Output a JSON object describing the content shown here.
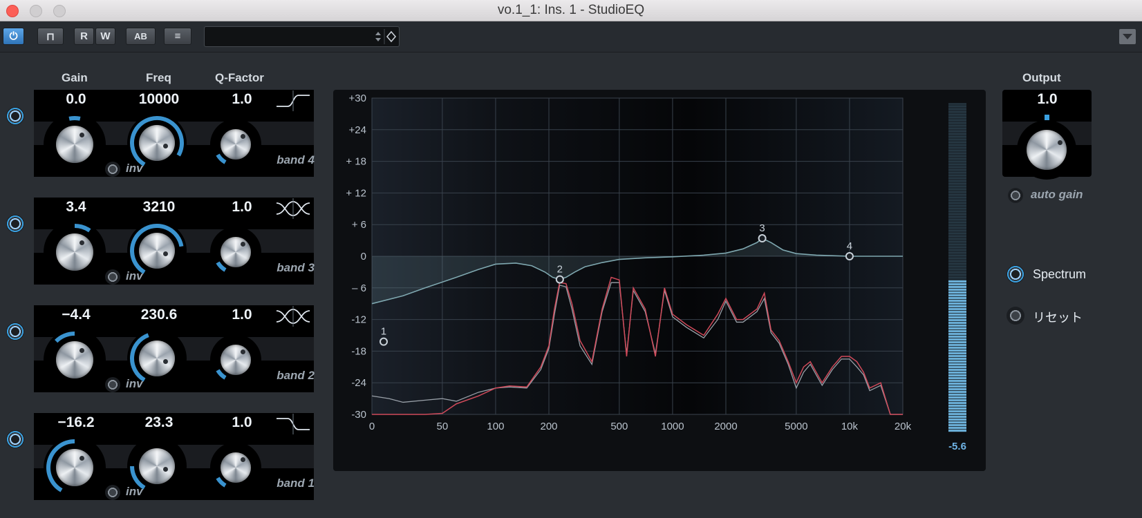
{
  "window": {
    "title": "vo.1_1: Ins. 1 - StudioEQ"
  },
  "toolbar": {
    "buttons": [
      {
        "name": "power",
        "glyph": "⏻"
      },
      {
        "name": "bypass",
        "glyph": "⊓"
      },
      {
        "name": "read",
        "glyph": "R"
      },
      {
        "name": "write",
        "glyph": "W"
      },
      {
        "name": "ab-compare",
        "glyph": "AB"
      },
      {
        "name": "settings",
        "glyph": "≡"
      }
    ],
    "preset_value": ""
  },
  "columns": {
    "gain": "Gain",
    "freq": "Freq",
    "q": "Q-Factor"
  },
  "bands": [
    {
      "id": 4,
      "label": "band 4",
      "enabled": true,
      "gain": "0.0",
      "freq": "10000",
      "q": "1.0",
      "inv": "inv",
      "shape": "high-shelf"
    },
    {
      "id": 3,
      "label": "band 3",
      "enabled": true,
      "gain": "3.4",
      "freq": "3210",
      "q": "1.0",
      "inv": "inv",
      "shape": "peak"
    },
    {
      "id": 2,
      "label": "band 2",
      "enabled": true,
      "gain": "−4.4",
      "freq": "230.6",
      "q": "1.0",
      "inv": "inv",
      "shape": "peak"
    },
    {
      "id": 1,
      "label": "band 1",
      "enabled": true,
      "gain": "−16.2",
      "freq": "23.3",
      "q": "1.0",
      "inv": "inv",
      "shape": "low-shelf"
    }
  ],
  "output": {
    "label": "Output",
    "value": "1.0",
    "auto_gain": "auto gain"
  },
  "spectrum": {
    "label": "Spectrum",
    "on": true
  },
  "reset": {
    "label": "リセット"
  },
  "meter": {
    "value": "-5.6"
  },
  "chart_data": {
    "type": "line",
    "y_tick_labels": [
      "+30",
      "+24",
      "+ 18",
      "+ 12",
      "+ 6",
      "0",
      "– 6",
      "-12",
      "-18",
      "-24",
      "-30"
    ],
    "x_tick_labels": [
      "0",
      "50",
      "100",
      "200",
      "500",
      "1000",
      "2000",
      "5000",
      "10k",
      "20k"
    ],
    "ylim": [
      -30,
      30
    ],
    "xlim": [
      20,
      20000
    ],
    "x_scale": "log",
    "nodes": [
      {
        "label": "1",
        "freq": 23.3,
        "gain": -16.2
      },
      {
        "label": "2",
        "freq": 230.6,
        "gain": -4.4
      },
      {
        "label": "3",
        "freq": 3210,
        "gain": 3.4
      },
      {
        "label": "4",
        "freq": 10000,
        "gain": 0.0
      }
    ],
    "series": [
      {
        "x": [
          20,
          30,
          40,
          60,
          80,
          100,
          130,
          160,
          190,
          210,
          230,
          250,
          280,
          320,
          400,
          500,
          700,
          1000,
          1500,
          2000,
          2500,
          3000,
          3210,
          3600,
          4200,
          5000,
          6500,
          8000,
          10000,
          15000,
          20000
        ],
        "y": [
          -9,
          -7.5,
          -6,
          -4,
          -2.5,
          -1.5,
          -1.3,
          -1.8,
          -3,
          -4,
          -4.4,
          -4,
          -3,
          -2,
          -1.2,
          -0.6,
          -0.3,
          -0.1,
          0.2,
          0.6,
          1.4,
          2.6,
          3.4,
          2.6,
          1.2,
          0.5,
          0.2,
          0.1,
          0,
          0,
          0
        ]
      },
      {
        "x": [
          20,
          25,
          30,
          40,
          50,
          60,
          80,
          100,
          120,
          150,
          180,
          200,
          215,
          230,
          250,
          270,
          300,
          350,
          400,
          450,
          500,
          550,
          600,
          700,
          800,
          900,
          1000,
          1200,
          1500,
          1800,
          2000,
          2300,
          2500,
          3000,
          3300,
          3600,
          4000,
          4500,
          5000,
          5500,
          6000,
          7000,
          8000,
          9000,
          10000,
          11000,
          12000,
          13000,
          15000,
          17000,
          20000
        ],
        "y": [
          -30,
          -30,
          -30,
          -30,
          -29.8,
          -28,
          -26.5,
          -25,
          -24.6,
          -24.8,
          -21,
          -17,
          -10,
          -5,
          -5.2,
          -9,
          -16,
          -20,
          -10,
          -4,
          -4.5,
          -19,
          -6,
          -10,
          -19,
          -6,
          -11,
          -13,
          -15,
          -11,
          -8,
          -12,
          -12,
          -10,
          -7,
          -14,
          -16,
          -20,
          -24,
          -21,
          -20,
          -24,
          -21,
          -19,
          -19,
          -20,
          -22,
          -25,
          -24,
          -30,
          -30
        ]
      },
      {
        "x": [
          20,
          25,
          30,
          40,
          50,
          60,
          80,
          100,
          120,
          150,
          180,
          200,
          215,
          230,
          250,
          270,
          300,
          350,
          400,
          450,
          500,
          550,
          600,
          700,
          800,
          900,
          1000,
          1200,
          1500,
          1800,
          2000,
          2300,
          2500,
          3000,
          3300,
          3600,
          4000,
          4500,
          5000,
          5500,
          6000,
          7000,
          8000,
          9000,
          10000,
          11000,
          12000,
          13000,
          15000,
          17000,
          20000
        ],
        "y": [
          -26.5,
          -27,
          -27.7,
          -27.3,
          -27,
          -27.5,
          -25.8,
          -25,
          -24.8,
          -25,
          -21.5,
          -17.5,
          -11,
          -5.5,
          -5.8,
          -10,
          -17,
          -20.5,
          -10.5,
          -5,
          -5,
          -18.5,
          -6.5,
          -10.5,
          -18.5,
          -6.5,
          -11.5,
          -13.5,
          -15.5,
          -12,
          -8.5,
          -12.5,
          -12.5,
          -10.5,
          -8,
          -14.5,
          -16.5,
          -20.5,
          -25,
          -22,
          -20.5,
          -24.5,
          -21.5,
          -19.5,
          -19.5,
          -21,
          -22.5,
          -25.5,
          -24.5,
          -30,
          -30
        ]
      }
    ]
  }
}
